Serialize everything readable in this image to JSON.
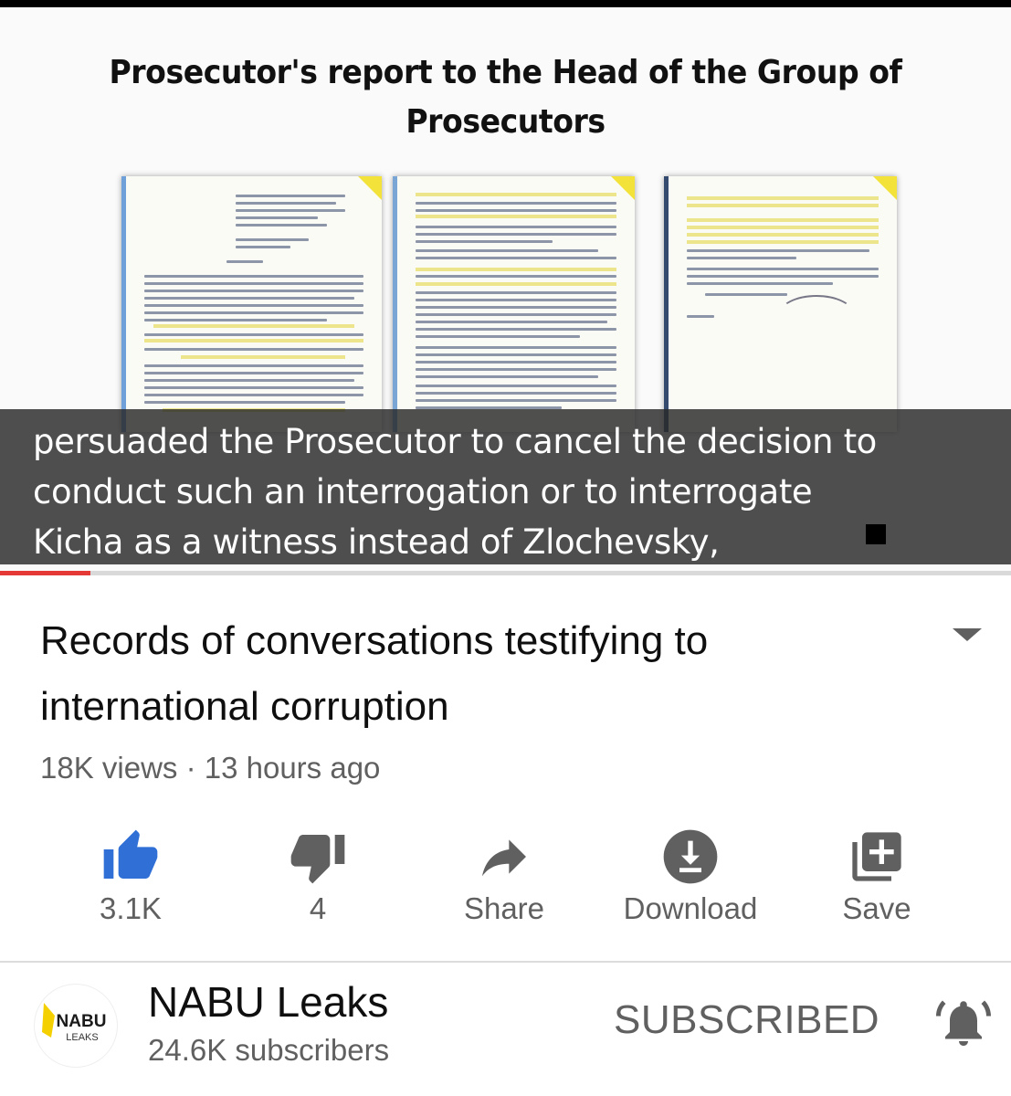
{
  "video": {
    "heading": "Prosecutor's report to the Head of the Group of Prosecutors",
    "captions": [
      "persuaded the Prosecutor to cancel the decision to",
      "conduct such an interrogation or to interrogate",
      "Kicha as a witness instead of Zlochevsky,"
    ],
    "progress_fraction": 0.089,
    "progress_color": "#e53935"
  },
  "details": {
    "title": "Records of conversations testifying to international corruption",
    "views": "18K views",
    "separator": "·",
    "age": "13 hours ago"
  },
  "actions": [
    {
      "icon": "thumbs-up-icon",
      "label": "3.1K",
      "color": "#2f6fd6"
    },
    {
      "icon": "thumbs-down-icon",
      "label": "4",
      "color": "#606060"
    },
    {
      "icon": "share-icon",
      "label": "Share",
      "color": "#606060"
    },
    {
      "icon": "download-icon",
      "label": "Download",
      "color": "#606060"
    },
    {
      "icon": "save-playlist-icon",
      "label": "Save",
      "color": "#606060"
    }
  ],
  "channel": {
    "name": "NABU Leaks",
    "subscribers": "24.6K subscribers",
    "avatar_text_top": "NABU",
    "avatar_text_bottom": "LEAKS",
    "subscribe_state": "SUBSCRIBED",
    "bell_icon": "notification-bell-icon"
  }
}
